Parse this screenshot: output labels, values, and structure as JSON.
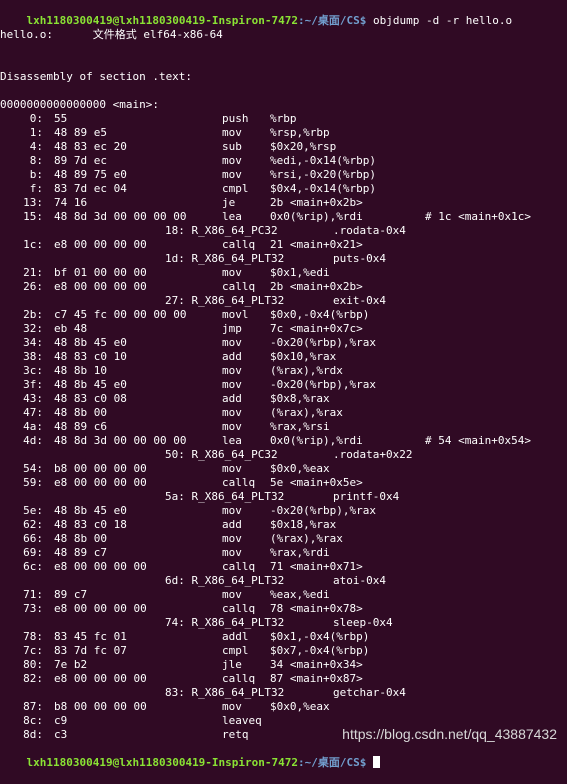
{
  "prompt_top": {
    "user": "lxh1180300419@lxh1180300419-Inspiron-7472",
    "path": ":~/桌面/CS$",
    "command": " objdump -d -r hello.o"
  },
  "file_info": "hello.o:      文件格式 elf64-x86-64",
  "section_header": "Disassembly of section .text:",
  "func_header": "0000000000000000 <main>:",
  "instructions": [
    {
      "addr": "0:",
      "bytes": "55",
      "mn": "push",
      "ops": "%rbp",
      "cmt": ""
    },
    {
      "addr": "1:",
      "bytes": "48 89 e5",
      "mn": "mov",
      "ops": "%rsp,%rbp",
      "cmt": ""
    },
    {
      "addr": "4:",
      "bytes": "48 83 ec 20",
      "mn": "sub",
      "ops": "$0x20,%rsp",
      "cmt": ""
    },
    {
      "addr": "8:",
      "bytes": "89 7d ec",
      "mn": "mov",
      "ops": "%edi,-0x14(%rbp)",
      "cmt": ""
    },
    {
      "addr": "b:",
      "bytes": "48 89 75 e0",
      "mn": "mov",
      "ops": "%rsi,-0x20(%rbp)",
      "cmt": ""
    },
    {
      "addr": "f:",
      "bytes": "83 7d ec 04",
      "mn": "cmpl",
      "ops": "$0x4,-0x14(%rbp)",
      "cmt": ""
    },
    {
      "addr": "13:",
      "bytes": "74 16",
      "mn": "je",
      "ops": "2b <main+0x2b>",
      "cmt": ""
    },
    {
      "addr": "15:",
      "bytes": "48 8d 3d 00 00 00 00",
      "mn": "lea",
      "ops": "0x0(%rip),%rdi",
      "cmt": "# 1c <main+0x1c>"
    },
    {
      "reloc": "18: R_X86_64_PC32",
      "sym": ".rodata-0x4"
    },
    {
      "addr": "1c:",
      "bytes": "e8 00 00 00 00",
      "mn": "callq",
      "ops": "21 <main+0x21>",
      "cmt": ""
    },
    {
      "reloc": "1d: R_X86_64_PLT32",
      "sym": "puts-0x4"
    },
    {
      "addr": "21:",
      "bytes": "bf 01 00 00 00",
      "mn": "mov",
      "ops": "$0x1,%edi",
      "cmt": ""
    },
    {
      "addr": "26:",
      "bytes": "e8 00 00 00 00",
      "mn": "callq",
      "ops": "2b <main+0x2b>",
      "cmt": ""
    },
    {
      "reloc": "27: R_X86_64_PLT32",
      "sym": "exit-0x4"
    },
    {
      "addr": "2b:",
      "bytes": "c7 45 fc 00 00 00 00",
      "mn": "movl",
      "ops": "$0x0,-0x4(%rbp)",
      "cmt": ""
    },
    {
      "addr": "32:",
      "bytes": "eb 48",
      "mn": "jmp",
      "ops": "7c <main+0x7c>",
      "cmt": ""
    },
    {
      "addr": "34:",
      "bytes": "48 8b 45 e0",
      "mn": "mov",
      "ops": "-0x20(%rbp),%rax",
      "cmt": ""
    },
    {
      "addr": "38:",
      "bytes": "48 83 c0 10",
      "mn": "add",
      "ops": "$0x10,%rax",
      "cmt": ""
    },
    {
      "addr": "3c:",
      "bytes": "48 8b 10",
      "mn": "mov",
      "ops": "(%rax),%rdx",
      "cmt": ""
    },
    {
      "addr": "3f:",
      "bytes": "48 8b 45 e0",
      "mn": "mov",
      "ops": "-0x20(%rbp),%rax",
      "cmt": ""
    },
    {
      "addr": "43:",
      "bytes": "48 83 c0 08",
      "mn": "add",
      "ops": "$0x8,%rax",
      "cmt": ""
    },
    {
      "addr": "47:",
      "bytes": "48 8b 00",
      "mn": "mov",
      "ops": "(%rax),%rax",
      "cmt": ""
    },
    {
      "addr": "4a:",
      "bytes": "48 89 c6",
      "mn": "mov",
      "ops": "%rax,%rsi",
      "cmt": ""
    },
    {
      "addr": "4d:",
      "bytes": "48 8d 3d 00 00 00 00",
      "mn": "lea",
      "ops": "0x0(%rip),%rdi",
      "cmt": "# 54 <main+0x54>"
    },
    {
      "reloc": "50: R_X86_64_PC32",
      "sym": ".rodata+0x22"
    },
    {
      "addr": "54:",
      "bytes": "b8 00 00 00 00",
      "mn": "mov",
      "ops": "$0x0,%eax",
      "cmt": ""
    },
    {
      "addr": "59:",
      "bytes": "e8 00 00 00 00",
      "mn": "callq",
      "ops": "5e <main+0x5e>",
      "cmt": ""
    },
    {
      "reloc": "5a: R_X86_64_PLT32",
      "sym": "printf-0x4"
    },
    {
      "addr": "5e:",
      "bytes": "48 8b 45 e0",
      "mn": "mov",
      "ops": "-0x20(%rbp),%rax",
      "cmt": ""
    },
    {
      "addr": "62:",
      "bytes": "48 83 c0 18",
      "mn": "add",
      "ops": "$0x18,%rax",
      "cmt": ""
    },
    {
      "addr": "66:",
      "bytes": "48 8b 00",
      "mn": "mov",
      "ops": "(%rax),%rax",
      "cmt": ""
    },
    {
      "addr": "69:",
      "bytes": "48 89 c7",
      "mn": "mov",
      "ops": "%rax,%rdi",
      "cmt": ""
    },
    {
      "addr": "6c:",
      "bytes": "e8 00 00 00 00",
      "mn": "callq",
      "ops": "71 <main+0x71>",
      "cmt": ""
    },
    {
      "reloc": "6d: R_X86_64_PLT32",
      "sym": "atoi-0x4"
    },
    {
      "addr": "71:",
      "bytes": "89 c7",
      "mn": "mov",
      "ops": "%eax,%edi",
      "cmt": ""
    },
    {
      "addr": "73:",
      "bytes": "e8 00 00 00 00",
      "mn": "callq",
      "ops": "78 <main+0x78>",
      "cmt": ""
    },
    {
      "reloc": "74: R_X86_64_PLT32",
      "sym": "sleep-0x4"
    },
    {
      "addr": "78:",
      "bytes": "83 45 fc 01",
      "mn": "addl",
      "ops": "$0x1,-0x4(%rbp)",
      "cmt": ""
    },
    {
      "addr": "7c:",
      "bytes": "83 7d fc 07",
      "mn": "cmpl",
      "ops": "$0x7,-0x4(%rbp)",
      "cmt": ""
    },
    {
      "addr": "80:",
      "bytes": "7e b2",
      "mn": "jle",
      "ops": "34 <main+0x34>",
      "cmt": ""
    },
    {
      "addr": "82:",
      "bytes": "e8 00 00 00 00",
      "mn": "callq",
      "ops": "87 <main+0x87>",
      "cmt": ""
    },
    {
      "reloc": "83: R_X86_64_PLT32",
      "sym": "getchar-0x4"
    },
    {
      "addr": "87:",
      "bytes": "b8 00 00 00 00",
      "mn": "mov",
      "ops": "$0x0,%eax",
      "cmt": ""
    },
    {
      "addr": "8c:",
      "bytes": "c9",
      "mn": "leaveq",
      "ops": "",
      "cmt": ""
    },
    {
      "addr": "8d:",
      "bytes": "c3",
      "mn": "retq",
      "ops": "",
      "cmt": ""
    }
  ],
  "prompt_bottom": {
    "user": "lxh1180300419@lxh1180300419-Inspiron-7472",
    "path": ":~/桌面/CS$",
    "command": " "
  },
  "watermark": "https://blog.csdn.net/qq_43887432",
  "colors": {
    "background": "#300a24",
    "prompt_user": "#8ae234",
    "prompt_path": "#729fcf",
    "text": "#ffffff"
  }
}
